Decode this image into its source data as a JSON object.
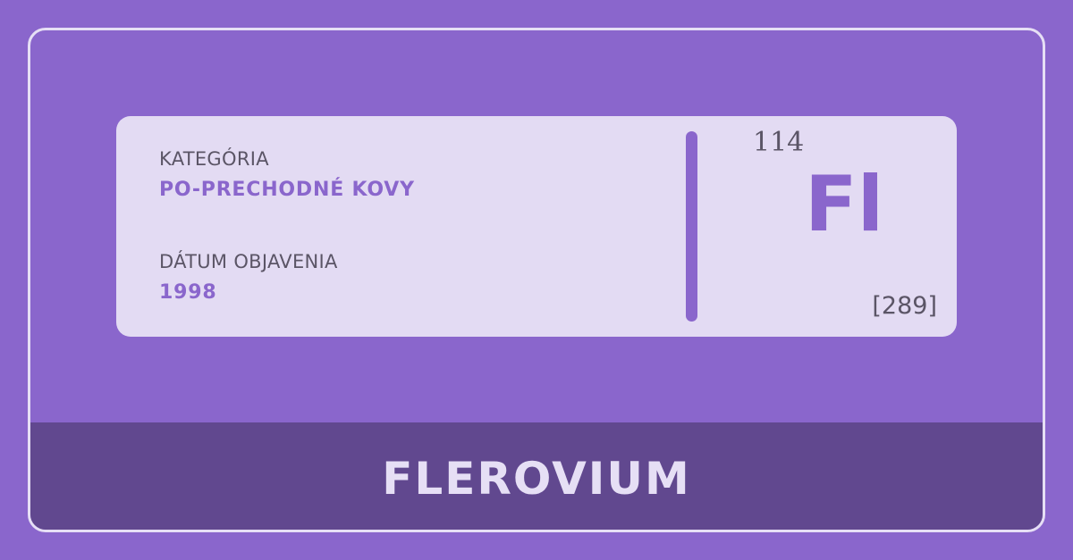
{
  "element": {
    "category_label": "KATEGÓRIA",
    "category_value": "PO-PRECHODNÉ KOVY",
    "discovery_label": "DÁTUM OBJAVENIA",
    "discovery_value": "1998",
    "atomic_number": "114",
    "symbol": "Fl",
    "atomic_mass": "[289]",
    "name": "FLEROVIUM"
  },
  "colors": {
    "background": "#8a66cc",
    "card": "#e3dbf3",
    "accent": "#8a66cc",
    "band": "#61488f",
    "text_dark": "#5b5566",
    "text_light": "#e6dff5"
  }
}
